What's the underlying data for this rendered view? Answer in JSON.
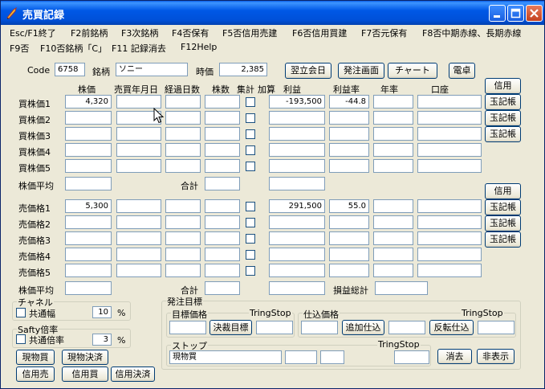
{
  "window": {
    "title": "売買記録"
  },
  "menu": [
    "Esc/F1終了",
    "F2前銘柄",
    "F3次銘柄",
    "F4否保有",
    "F5否信用売建",
    "F6否信用買建",
    "F7否元保有",
    "F8否中期赤線、長期赤線",
    "F9否",
    "F10否銘柄「C」",
    "F11 記録消去",
    "F12Help"
  ],
  "header": {
    "code_label": "Code",
    "code_value": "6758",
    "name_label": "銘柄",
    "name_value": "ソニー",
    "price_label": "時価",
    "price_value": "2,385",
    "buttons": [
      "翌立会日",
      "発注画面",
      "チャート",
      "電卓"
    ]
  },
  "columns": [
    "株価",
    "売買年月日",
    "経過日数",
    "株数",
    "集計",
    "加算",
    "利益",
    "利益率",
    "年率",
    "口座"
  ],
  "buy_rows": [
    {
      "label": "買株価1",
      "price": "4,320",
      "profit": "-193,500",
      "rate": "-44.8"
    },
    {
      "label": "買株価2",
      "price": "",
      "profit": "",
      "rate": ""
    },
    {
      "label": "買株価3",
      "price": "",
      "profit": "",
      "rate": ""
    },
    {
      "label": "買株価4",
      "price": "",
      "profit": "",
      "rate": ""
    },
    {
      "label": "買株価5",
      "price": "",
      "profit": "",
      "rate": ""
    }
  ],
  "buy_side_buttons": [
    "信用",
    "玉記帳",
    "玉記帳",
    "玉記帳"
  ],
  "sell_rows": [
    {
      "label": "売価格1",
      "price": "5,300",
      "profit": "291,500",
      "rate": "55.0"
    },
    {
      "label": "売価格2",
      "price": "",
      "profit": "",
      "rate": ""
    },
    {
      "label": "売価格3",
      "price": "",
      "profit": "",
      "rate": ""
    },
    {
      "label": "売価格4",
      "price": "",
      "profit": "",
      "rate": ""
    },
    {
      "label": "売価格5",
      "price": "",
      "profit": "",
      "rate": ""
    }
  ],
  "sell_side_buttons": [
    "信用",
    "玉記帳",
    "玉記帳",
    "玉記帳"
  ],
  "avg_label": "株価平均",
  "total_label": "合計",
  "pl_total_label": "損益総計",
  "channel": {
    "title": "チャネル",
    "check_label": "共通幅",
    "value": "10",
    "unit": "%"
  },
  "safety": {
    "title": "Safty倍率",
    "check_label": "共通倍率",
    "value": "3",
    "unit": "%"
  },
  "bottom_buttons": [
    "現物買",
    "現物決済",
    "信用売",
    "信用買",
    "信用決済"
  ],
  "order": {
    "title": "発注目標",
    "target_title": "目標価格",
    "tring1": "TringStop",
    "settle_btn": "決裁目標",
    "purchase_title": "仕込価格",
    "tring2": "TringStop",
    "add_btn": "追加仕込",
    "reverse_btn": "反転仕込",
    "stop_title": "ストップ",
    "tring3": "TringStop",
    "stop_value": "現物買",
    "clear_btn": "消去",
    "hide_btn": "非表示"
  }
}
